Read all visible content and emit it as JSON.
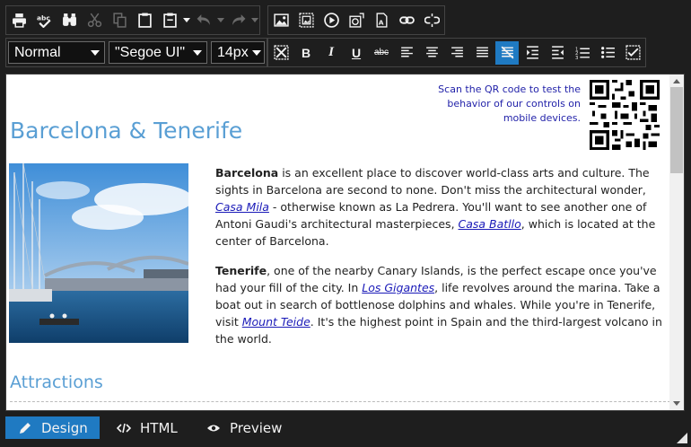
{
  "toolbar": {
    "format_block": "Normal",
    "font_name": "\"Segoe UI\"",
    "font_size": "14px"
  },
  "content": {
    "qr_text": "Scan the QR code to test the behavior of our controls on mobile devices.",
    "heading": "Barcelona & Tenerife",
    "p1": {
      "bold": "Barcelona",
      "t1": " is an excellent place to discover world-class arts and culture. The sights in Barcelona are second to none. Don't miss the architectural wonder, ",
      "link1": "Casa Mila",
      "t2": " - otherwise known as La Pedrera. You'll want to see another one of Antoni Gaudi's architectural masterpieces, ",
      "link2": "Casa Batllo",
      "t3": ", which is located at the center of Barcelona."
    },
    "p2": {
      "bold": "Tenerife",
      "t1": ", one of the nearby Canary Islands, is the perfect escape once you've had your fill of the city. In ",
      "link1": "Los Gigantes",
      "t2": ", life revolves around the marina. Take a boat out in search of bottlenose dolphins and whales. While you're in Tenerife, visit ",
      "link2": "Mount Teide",
      "t3": ". It's the highest point in Spain and the third-largest volcano in the world."
    },
    "heading2": "Attractions"
  },
  "modes": {
    "design": "Design",
    "html": "HTML",
    "preview": "Preview"
  },
  "colors": {
    "accent": "#1f7ac2",
    "heading": "#5a9fd4",
    "link": "#1a1ab8"
  }
}
